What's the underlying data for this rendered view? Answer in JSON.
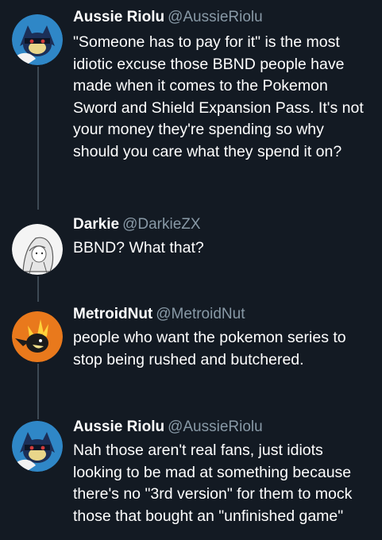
{
  "tweets": [
    {
      "name": "Aussie Riolu",
      "handle": "@AussieRiolu",
      "avatar_icon": "riolu-avatar-icon",
      "lines": [
        "\"Someone has to pay for it\" is the most",
        "idiotic excuse those BBND people have",
        "made when it comes to the Pokemon",
        "Sword and Shield Expansion Pass. It's not",
        "your money they're spending so why",
        "should you care what they spend it on?"
      ]
    },
    {
      "name": "Darkie",
      "handle": "@DarkieZX",
      "avatar_icon": "sketch-character-avatar-icon",
      "lines": [
        "BBND?  What that?"
      ]
    },
    {
      "name": "MetroidNut",
      "handle": "@MetroidNut",
      "avatar_icon": "fire-bird-avatar-icon",
      "lines": [
        "people who want the pokemon series to",
        "stop being rushed and butchered."
      ]
    },
    {
      "name": "Aussie Riolu",
      "handle": "@AussieRiolu",
      "avatar_icon": "riolu-avatar-icon",
      "lines": [
        "Nah those aren't real fans, just idiots",
        "looking to be mad at something because",
        "there's no \"3rd version\" for them to mock",
        "those that bought an \"unfinished game\""
      ]
    }
  ],
  "colors": {
    "background": "#131a23",
    "text": "#ffffff",
    "handle": "#8899a6",
    "thread_line": "#3d4954"
  }
}
